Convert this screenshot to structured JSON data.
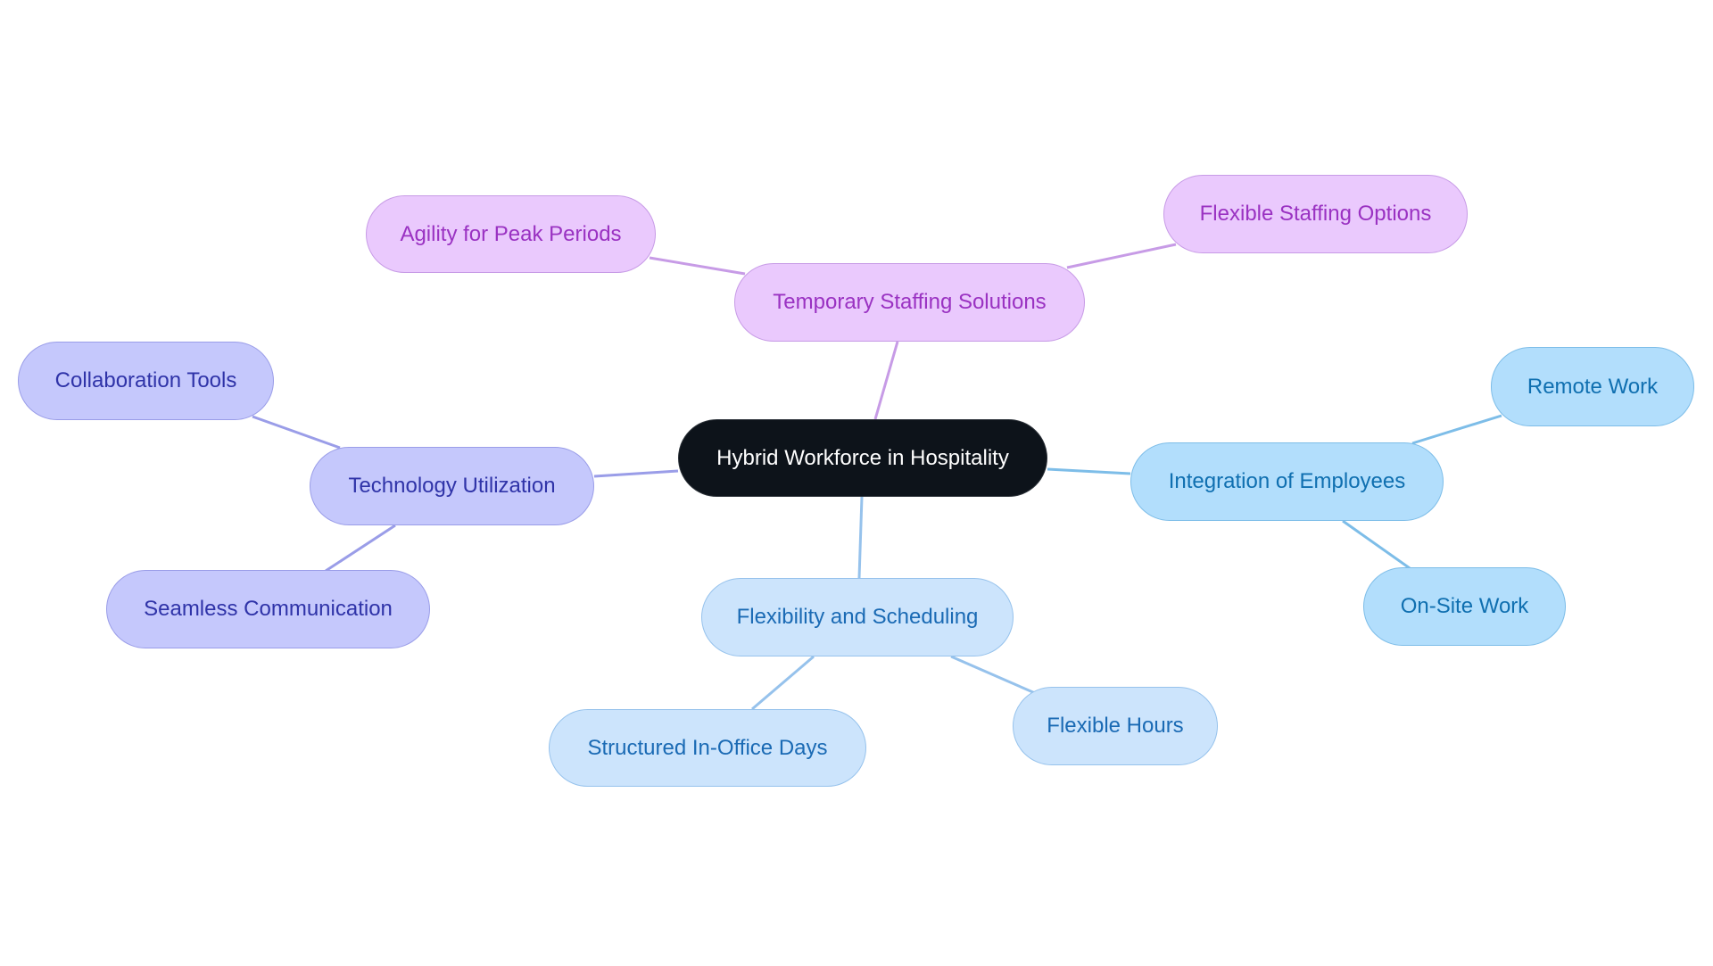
{
  "root": {
    "label": "Hybrid Workforce in Hospitality"
  },
  "branches": [
    {
      "label": "Temporary Staffing Solutions",
      "color": "#c79be6",
      "children": [
        {
          "label": "Agility for Peak Periods"
        },
        {
          "label": "Flexible Staffing Options"
        }
      ]
    },
    {
      "label": "Technology Utilization",
      "color": "#9a9de8",
      "children": [
        {
          "label": "Collaboration Tools"
        },
        {
          "label": "Seamless Communication"
        }
      ]
    },
    {
      "label": "Integration of Employees",
      "color": "#7dbde8",
      "children": [
        {
          "label": "Remote Work"
        },
        {
          "label": "On-Site Work"
        }
      ]
    },
    {
      "label": "Flexibility and Scheduling",
      "color": "#96c2ec",
      "children": [
        {
          "label": "Structured In-Office Days"
        },
        {
          "label": "Flexible Hours"
        }
      ]
    }
  ]
}
